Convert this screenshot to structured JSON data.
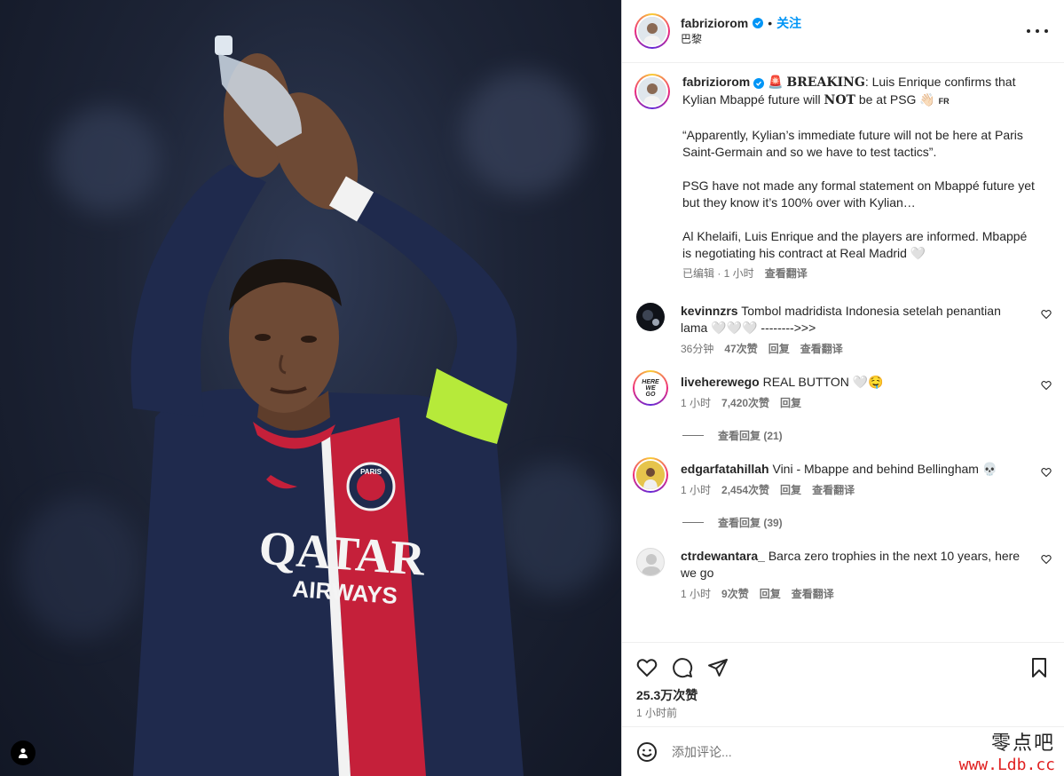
{
  "post": {
    "author": "fabriziorom",
    "follow_label": "关注",
    "dot": "•",
    "location": "巴黎",
    "media_alt": "Kylian Mbappé applauding fans in PSG Qatar Airways kit"
  },
  "caption": {
    "username": "fabriziorom",
    "breaking_emoji": "🚨",
    "breaking": "BREAKING",
    "line1_rest": ": Luis Enrique confirms that Kylian Mbappé future will ",
    "not_word": "NOT",
    "line1_end": " be at PSG 👋🏻",
    "flag_text": "FR",
    "para2": "“Apparently, Kylian’s immediate future will not be here at Paris Saint-Germain and so we have to test tactics”.",
    "para3": "PSG have not made any formal statement on Mbappé future yet but they know it’s 100% over with Kylian…",
    "para4": "Al Khelaifi, Luis Enrique and the players are informed. Mbappé is negotiating his contract at Real Madrid 🤍",
    "edited_time": "已编辑 · 1 小时",
    "translate": "查看翻译"
  },
  "comments": [
    {
      "username": "kevinnzrs",
      "text": "Tombol madridista Indonesia setelah penantian lama 🤍🤍🤍 -------->>>",
      "time": "36分钟",
      "likes": "47次赞",
      "reply": "回复",
      "translate": "查看翻译"
    },
    {
      "username": "liveherewego",
      "text": "REAL BUTTON 🤍🤤",
      "time": "1 小时",
      "likes": "7,420次赞",
      "reply": "回复",
      "view_replies": "查看回复 (21)",
      "avatar_text": "HERE WE GO"
    },
    {
      "username": "edgarfatahillah",
      "text": "Vini - Mbappe and behind Bellingham 💀",
      "time": "1 小时",
      "likes": "2,454次赞",
      "reply": "回复",
      "translate": "查看翻译",
      "view_replies": "查看回复 (39)"
    },
    {
      "username": "ctrdewantara_",
      "text": "Barca zero trophies in the next 10 years, here we go",
      "time": "1 小时",
      "likes": "9次赞",
      "reply": "回复",
      "translate": "查看翻译"
    }
  ],
  "actions": {
    "likes_count": "25.3万次赞",
    "posted_time": "1 小时前"
  },
  "composer": {
    "placeholder": "添加评论..."
  },
  "jersey": {
    "sponsor_line1": "QATAR",
    "sponsor_line2": "AIRWAYS",
    "badge_text": "PARIS"
  },
  "watermark": {
    "cn": "零点吧",
    "url": "www.Ldb.cc"
  },
  "colors": {
    "accent": "#0095f6",
    "psg_navy": "#1f2a4d",
    "psg_red": "#c5203a",
    "captain_band": "#b6ea3a",
    "muted_text": "#737373"
  }
}
